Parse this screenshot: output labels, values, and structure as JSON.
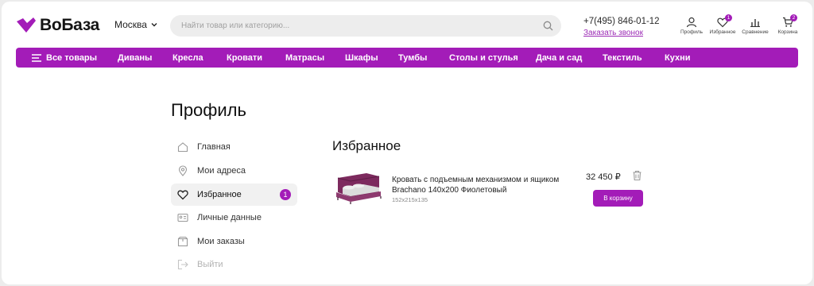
{
  "header": {
    "logo_text": "ВоБаза",
    "city": "Москва",
    "search": {
      "placeholder": "Найти товар или категорию..."
    },
    "phone": "+7(495) 846-01-12",
    "callback": "Заказать звонок",
    "icons": [
      {
        "name": "profile-icon",
        "label": "Профиль"
      },
      {
        "name": "favorites-icon",
        "label": "Избранное",
        "badge": "1"
      },
      {
        "name": "compare-icon",
        "label": "Сравнение"
      },
      {
        "name": "cart-icon",
        "label": "Корзина",
        "badge": "2"
      }
    ]
  },
  "nav": {
    "all_label": "Все товары",
    "items": [
      "Диваны",
      "Кресла",
      "Кровати",
      "Матрасы",
      "Шкафы",
      "Тумбы",
      "Столы и стулья",
      "Дача и сад",
      "Текстиль",
      "Кухни"
    ]
  },
  "profile": {
    "title": "Профиль",
    "menu": [
      {
        "label": "Главная",
        "icon": "home-icon"
      },
      {
        "label": "Мои адреса",
        "icon": "location-pin-icon"
      },
      {
        "label": "Избранное",
        "icon": "heart-icon",
        "active": true,
        "count": "1"
      },
      {
        "label": "Личные данные",
        "icon": "id-card-icon"
      },
      {
        "label": "Мои заказы",
        "icon": "box-icon"
      },
      {
        "label": "Выйти",
        "icon": "logout-icon",
        "dim": true
      }
    ]
  },
  "favorites": {
    "title": "Избранное",
    "items": [
      {
        "name": "Кровать с подъемным механизмом и ящиком Brachano 140x200 Фиолетовый",
        "size": "152x215x135",
        "price": "32 450 ₽",
        "button": "В корзину"
      }
    ]
  },
  "colors": {
    "accent": "#a31cb8",
    "background": "#ececec",
    "panel": "#ffffff"
  }
}
